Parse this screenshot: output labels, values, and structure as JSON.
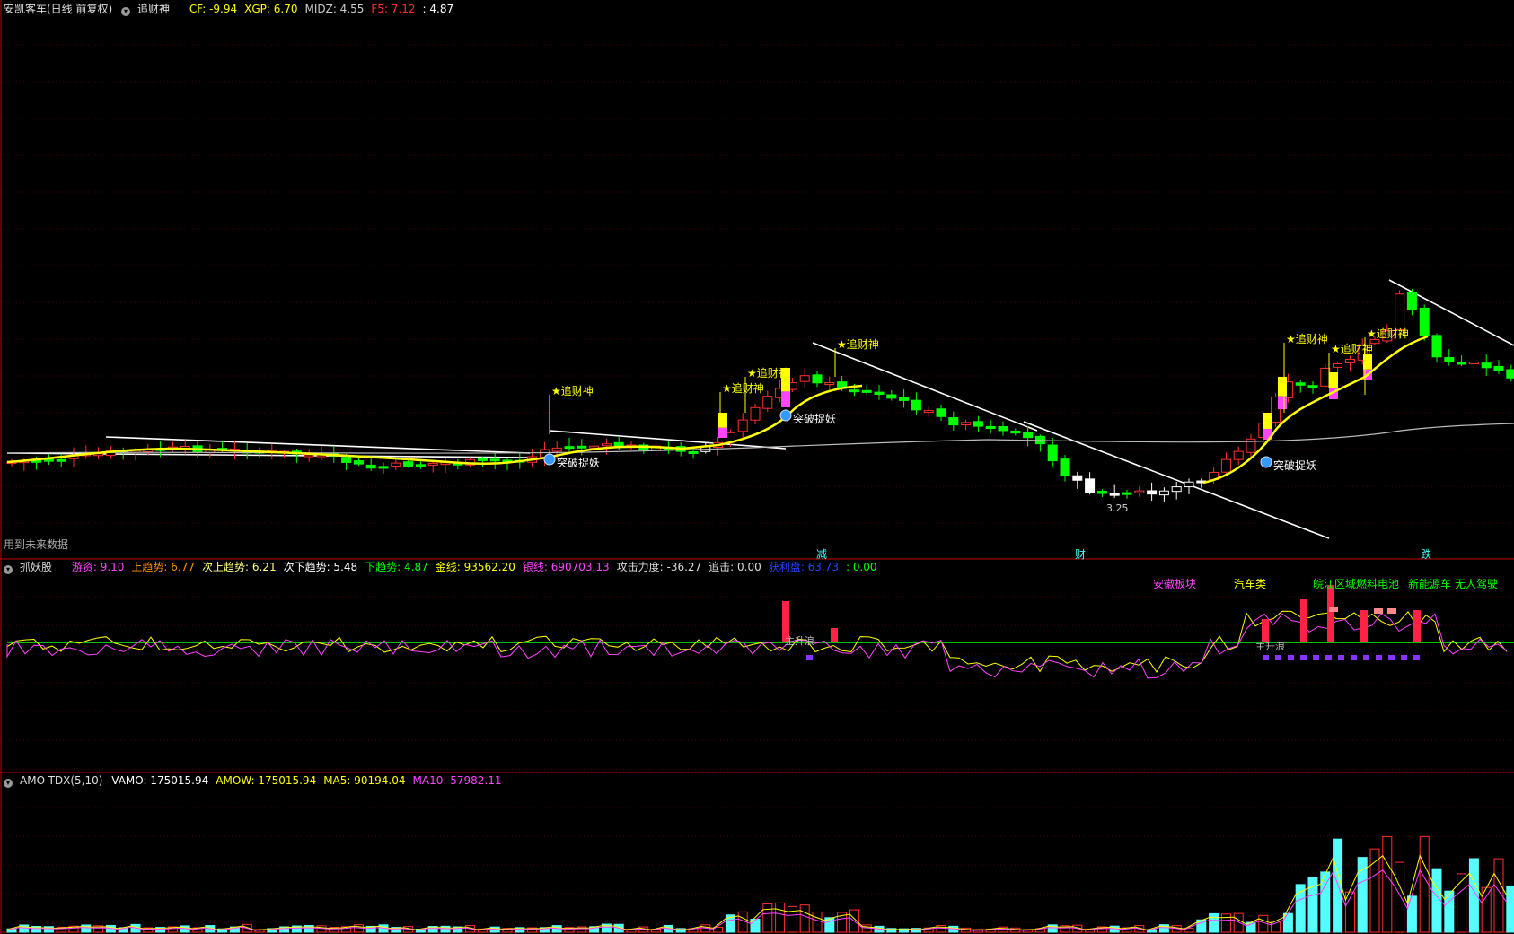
{
  "main_panel": {
    "title": "安凯客车(日线 前复权)",
    "indicator_name": "追财神",
    "values": [
      {
        "key": "CF",
        "text": "CF: -9.94",
        "color": "#ffff00"
      },
      {
        "key": "XGP",
        "text": "XGP: 6.70",
        "color": "#ffff00"
      },
      {
        "key": "MIDZ",
        "text": "MIDZ: 4.55",
        "color": "#cccccc"
      },
      {
        "key": "F5",
        "text": "F5: 7.12",
        "color": "#ff3030"
      },
      {
        "key": "blank",
        "text": ": 4.87",
        "color": "#ffffff"
      }
    ],
    "future_data_note": "用到未来数据",
    "signal_labels": {
      "zhuicaishen": "★追财神",
      "tupo": "突破捉妖"
    },
    "low_price_label": "3.25",
    "bottom_markers": [
      "减",
      "财",
      "跌"
    ]
  },
  "zhuayao_panel": {
    "title": "抓妖股",
    "values": [
      {
        "text": "游资: 9.10",
        "color": "#ff44ff"
      },
      {
        "text": "上趋势: 6.77",
        "color": "#ff8c00"
      },
      {
        "text": "次上趋势: 6.21",
        "color": "#ffff80"
      },
      {
        "text": "次下趋势: 5.48",
        "color": "#ffffff"
      },
      {
        "text": "下趋势: 4.87",
        "color": "#00ff00"
      },
      {
        "text": "金线: 93562.20",
        "color": "#ffff00"
      },
      {
        "text": "银线: 690703.13",
        "color": "#ff44ff"
      },
      {
        "text": "攻击力度: -36.27",
        "color": "#dddddd"
      },
      {
        "text": "追击: 0.00",
        "color": "#dddddd"
      },
      {
        "text": "获利盘: 63.73",
        "color": "#2244ff"
      },
      {
        "text": ": 0.00",
        "color": "#00ff00"
      }
    ],
    "concept_labels": [
      {
        "text": "安徽板块",
        "color": "#ff44ff"
      },
      {
        "text": "汽车类",
        "color": "#ffff00"
      },
      {
        "text": "皖江区域",
        "color": "#00ff00"
      },
      {
        "text": "燃料电池",
        "color": "#00ff00"
      },
      {
        "text": "新能源车",
        "color": "#00ff00"
      },
      {
        "text": "无人驾驶",
        "color": "#00ff00"
      }
    ],
    "rise_label": "主升浪"
  },
  "amo_panel": {
    "title": "AMO-TDX(5,10)",
    "values": [
      {
        "text": "VAMO: 175015.94",
        "color": "#ffffff"
      },
      {
        "text": "AMOW: 175015.94",
        "color": "#ffff00"
      },
      {
        "text": "MA5: 90194.04",
        "color": "#ffff00"
      },
      {
        "text": "MA10: 57982.11",
        "color": "#ff44ff"
      }
    ]
  },
  "colors": {
    "up": "#ff3030",
    "down": "#00ff00",
    "grid": "#4a0000",
    "border": "#c00000",
    "ma": "#ffff00",
    "trend": "#ffffff"
  }
}
